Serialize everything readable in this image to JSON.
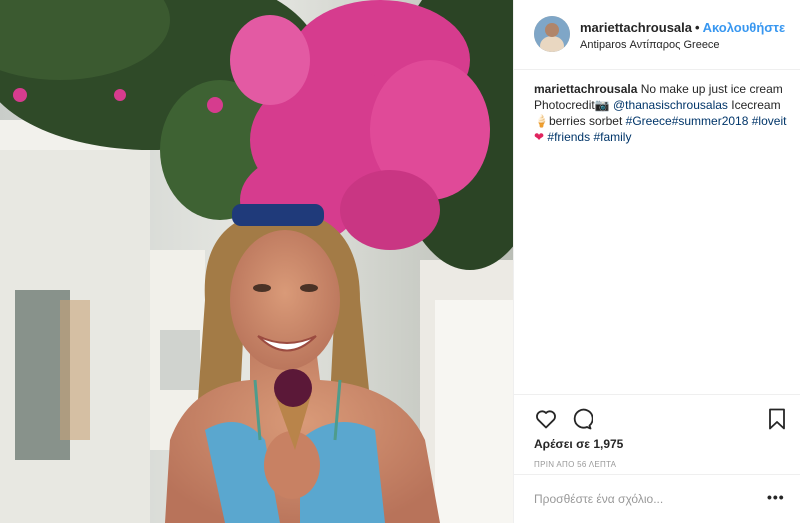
{
  "post": {
    "username": "mariettachrousala",
    "separator": "•",
    "follow_label": "Ακολουθήστε",
    "location": "Antiparos Αντίπαρος Greece"
  },
  "caption": {
    "username": "mariettachrousala",
    "text_1": " No make up just ice cream Photocredit",
    "camera_emoji": "📷",
    "mention": "@thanasischrousalas",
    "text_2": " Icecream ",
    "icecream_emoji": "🍦",
    "text_3": "berries sorbet ",
    "tag_greece": "#Greece",
    "tag_summer": "#summer2018",
    "tag_loveit": "#loveit",
    "heart_emoji": "❤",
    "tag_friends": "#friends",
    "tag_family": "#family"
  },
  "actions": {
    "like_icon": "heart-outline",
    "comment_icon": "speech-bubble",
    "save_icon": "bookmark"
  },
  "likes_text": "Αρέσει σε 1,975",
  "timestamp": "ΠΡΙΝ ΑΠΟ 56 ΛΕΠΤΑ",
  "comment": {
    "placeholder": "Προσθέστε ένα σχόλιο...",
    "more_label": "•••"
  },
  "colors": {
    "link_blue": "#3897f0",
    "hashtag": "#003569",
    "bougainvillea": "#d63c8e",
    "heart": "#e0245e"
  }
}
